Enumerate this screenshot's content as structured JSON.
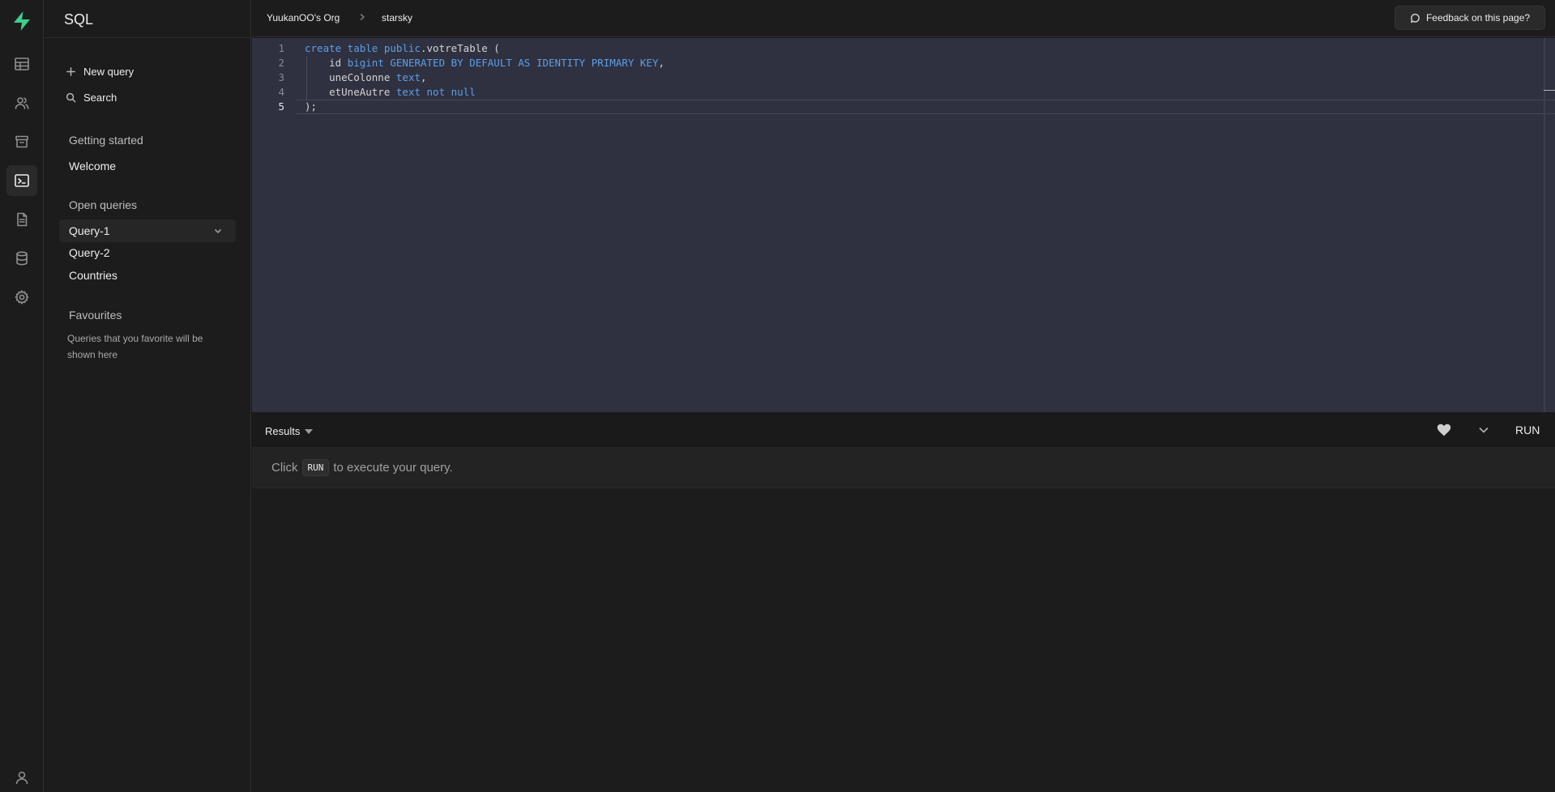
{
  "app": {
    "section_title": "SQL"
  },
  "breadcrumb": {
    "org": "YuukanOO's Org",
    "project": "starsky"
  },
  "header": {
    "feedback_label": "Feedback on this page?"
  },
  "sidebar": {
    "new_query": "New query",
    "search": "Search",
    "getting_started": "Getting started",
    "welcome": "Welcome",
    "open_queries": "Open queries",
    "queries": [
      "Query-1",
      "Query-2",
      "Countries"
    ],
    "favourites": "Favourites",
    "favourites_hint": "Queries that you favorite will be shown here"
  },
  "rail_icons": [
    "table-editor-icon",
    "users-icon",
    "storage-icon",
    "sql-editor-icon",
    "docs-icon",
    "database-icon",
    "settings-icon",
    "user-account-icon"
  ],
  "editor": {
    "line_numbers": [
      "1",
      "2",
      "3",
      "4",
      "5"
    ],
    "lines": [
      [
        [
          "kw",
          "create table public"
        ],
        [
          "",
          ".votreTable ("
        ]
      ],
      [
        [
          "",
          "    id "
        ],
        [
          "kw",
          "bigint GENERATED BY DEFAULT AS IDENTITY PRIMARY KEY"
        ],
        [
          "",
          ","
        ]
      ],
      [
        [
          "",
          "    uneColonne "
        ],
        [
          "kw",
          "text"
        ],
        [
          "",
          ","
        ]
      ],
      [
        [
          "",
          "    etUneAutre "
        ],
        [
          "kw",
          "text not null"
        ]
      ],
      [
        [
          "",
          ");"
        ]
      ]
    ]
  },
  "results": {
    "tab_label": "Results",
    "run_label": "RUN",
    "message_before": "Click",
    "message_kbd": "RUN",
    "message_after": "to execute your query."
  },
  "colors": {
    "brand": "#3ecf8e",
    "editor_bg": "#2f3140",
    "keyword": "#5c9ee8"
  }
}
